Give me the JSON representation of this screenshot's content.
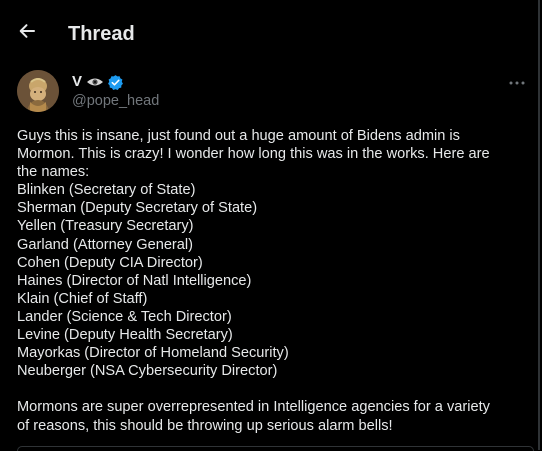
{
  "header": {
    "title": "Thread",
    "back_icon": "arrow-left-icon"
  },
  "author": {
    "display_name": "V",
    "name_emoji_icon": "eye-emoji-icon",
    "verified_icon": "verified-badge-icon",
    "handle": "@pope_head",
    "avatar_icon": "profile-avatar",
    "more_icon": "more-options-icon"
  },
  "post": {
    "intro_lines": [
      "Guys this is insane, just found out a huge amount of Bidens admin is",
      "Mormon. This is crazy! I wonder how long this was in the works. Here are",
      "the names:"
    ],
    "names": [
      "Blinken (Secretary of State)",
      "Sherman (Deputy Secretary of State)",
      "Yellen (Treasury Secretary)",
      "Garland (Attorney General)",
      "Cohen (Deputy CIA Director)",
      "Haines (Director of Natl Intelligence)",
      "Klain (Chief of Staff)",
      "Lander (Science & Tech Director)",
      "Levine (Deputy Health Secretary)",
      "Mayorkas (Director of Homeland Security)",
      "Neuberger (NSA Cybersecurity Director)"
    ],
    "closing_lines": [
      "Mormons are super overrepresented in Intelligence agencies for a variety",
      "of reasons, this should be throwing up serious alarm bells!"
    ]
  },
  "colors": {
    "background": "#000000",
    "text": "#e7e9ea",
    "secondary_text": "#71767b",
    "verified_blue": "#1d9bf0",
    "divider": "#2f3336"
  }
}
